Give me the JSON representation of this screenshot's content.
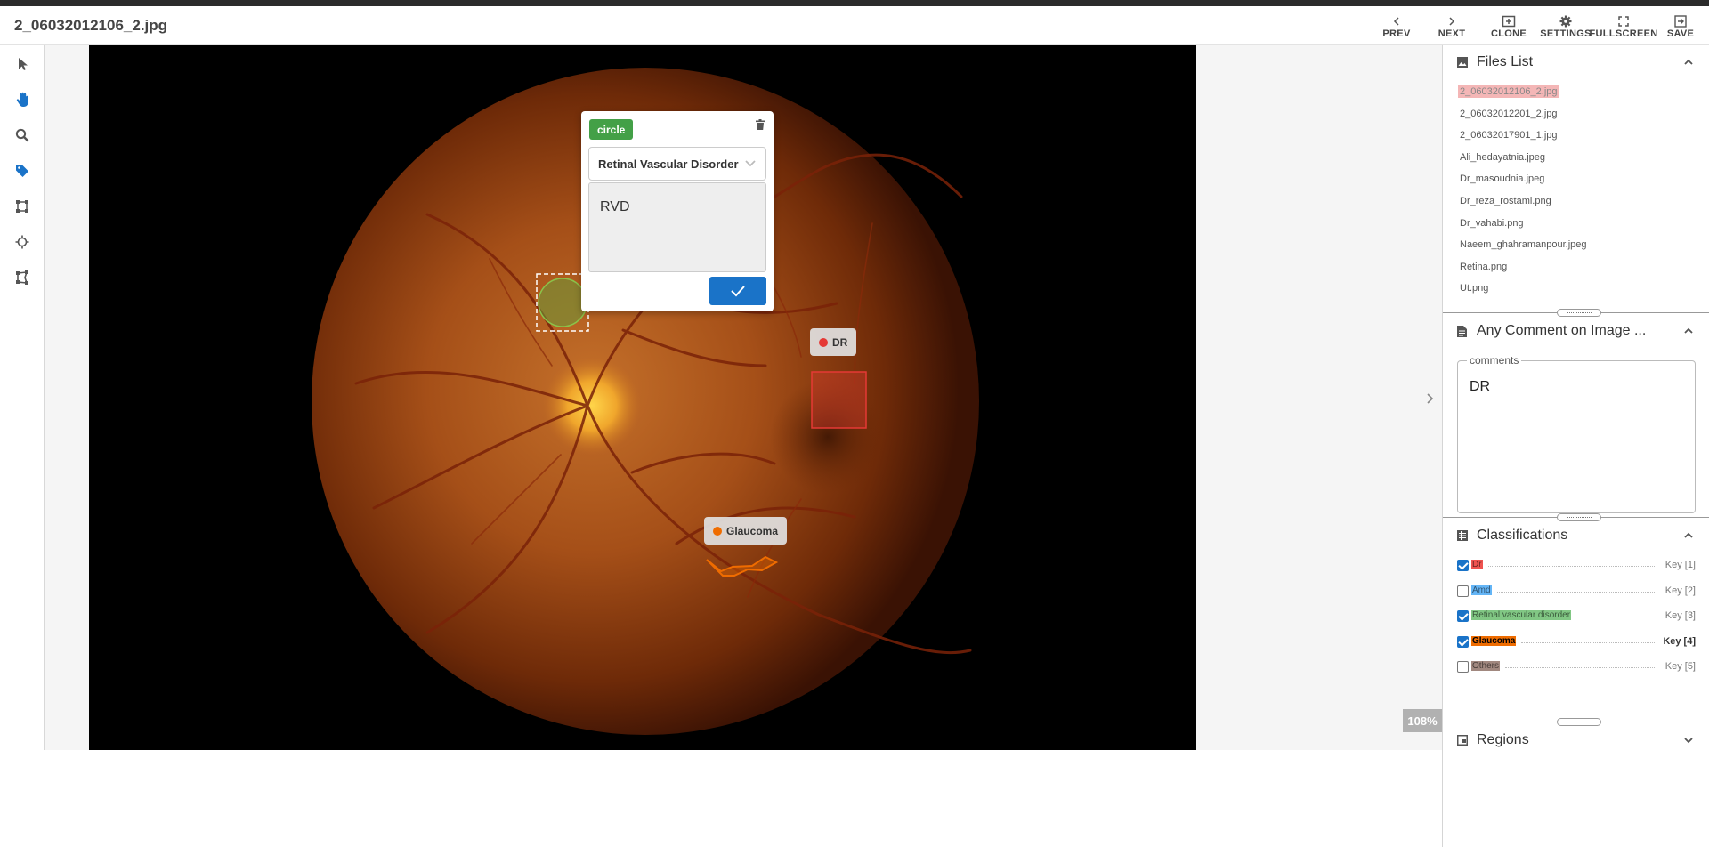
{
  "header": {
    "filename": "2_06032012106_2.jpg",
    "buttons": [
      {
        "label": "PREV",
        "icon": "chevron-left-icon"
      },
      {
        "label": "NEXT",
        "icon": "chevron-right-icon"
      },
      {
        "label": "CLONE",
        "icon": "clone-icon"
      },
      {
        "label": "SETTINGS",
        "icon": "gear-icon"
      },
      {
        "label": "FULLSCREEN",
        "icon": "fullscreen-icon"
      },
      {
        "label": "SAVE",
        "icon": "exit-save-icon"
      }
    ]
  },
  "toolbar": {
    "tools": [
      {
        "name": "select-tool",
        "icon": "cursor-icon",
        "active": false
      },
      {
        "name": "pan-tool",
        "icon": "hand-icon",
        "active": true
      },
      {
        "name": "zoom-tool",
        "icon": "magnifier-icon",
        "active": false
      },
      {
        "name": "tag-tool",
        "icon": "tag-icon",
        "active": true
      },
      {
        "name": "box-tool",
        "icon": "bounding-box-icon",
        "active": false
      },
      {
        "name": "point-tool",
        "icon": "crosshair-icon",
        "active": false
      },
      {
        "name": "polygon-tool",
        "icon": "polygon-icon",
        "active": false
      }
    ]
  },
  "canvas": {
    "zoom": "108%",
    "regions": [
      {
        "label": "DR",
        "color": "#e53935"
      },
      {
        "label": "Glaucoma",
        "color": "#ef6c00"
      }
    ]
  },
  "editor": {
    "shape": "circle",
    "classification": "Retinal Vascular Disorder",
    "comment": "RVD",
    "shape_color": "#43a047"
  },
  "sidebar": {
    "files_title": "Files List",
    "files": [
      "2_06032012106_2.jpg",
      "2_06032012201_2.jpg",
      "2_06032017901_1.jpg",
      "Ali_hedayatnia.jpeg",
      "Dr_masoudnia.jpeg",
      "Dr_reza_rostami.png",
      "Dr_vahabi.png",
      "Naeem_ghahramanpour.jpeg",
      "Retina.png",
      "Ut.png"
    ],
    "selected_file": 0,
    "comment_title": "Any Comment on Image ...",
    "comments_legend": "comments",
    "comments_value": "DR",
    "classifications_title": "Classifications",
    "classifications": [
      {
        "name": "Dr",
        "key": "Key [1]",
        "checked": true,
        "color": "#ef5350"
      },
      {
        "name": "Amd",
        "key": "Key [2]",
        "checked": false,
        "color": "#64b5f6"
      },
      {
        "name": "Retinal vascular disorder",
        "key": "Key [3]",
        "checked": true,
        "color": "#81c784"
      },
      {
        "name": "Glaucoma",
        "key": "Key [4]",
        "checked": true,
        "color": "#ef6c00"
      },
      {
        "name": "Others",
        "key": "Key [5]",
        "checked": false,
        "color": "#a1887f"
      }
    ],
    "regions_title": "Regions"
  }
}
